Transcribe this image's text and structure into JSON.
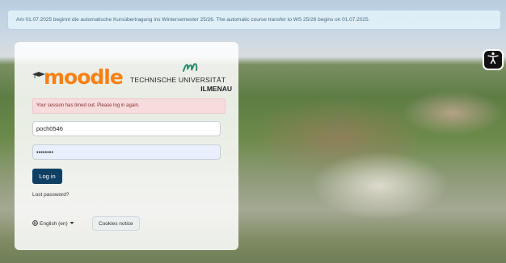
{
  "banner": {
    "text": "Am 01.07.2025 beginnt die automatische Kursübertragung ins Wintersemester 25/26. The automatic course transfer to WS 25/26 begins on 01.07.2025."
  },
  "logo": {
    "moodle_text": "moodle",
    "tu_line1": "TECHNISCHE UNIVERSITÄT",
    "tu_line2": "ILMENAU"
  },
  "alert": {
    "text": "Your session has timed out. Please log in again."
  },
  "form": {
    "username_value": "poch0546",
    "password_value": "••••••••",
    "login_label": "Log in",
    "lost_password": "Lost password?"
  },
  "footer": {
    "language": "English (en)",
    "cookies": "Cookies notice"
  },
  "icons": {
    "accessibility": "accessibility-icon",
    "globe": "globe-icon",
    "caret": "caret-down-icon"
  },
  "colors": {
    "moodle_orange": "#f98012",
    "tu_green": "#2f8a6e",
    "login_button": "#0f3f63",
    "alert_bg": "#f6dcdc"
  }
}
